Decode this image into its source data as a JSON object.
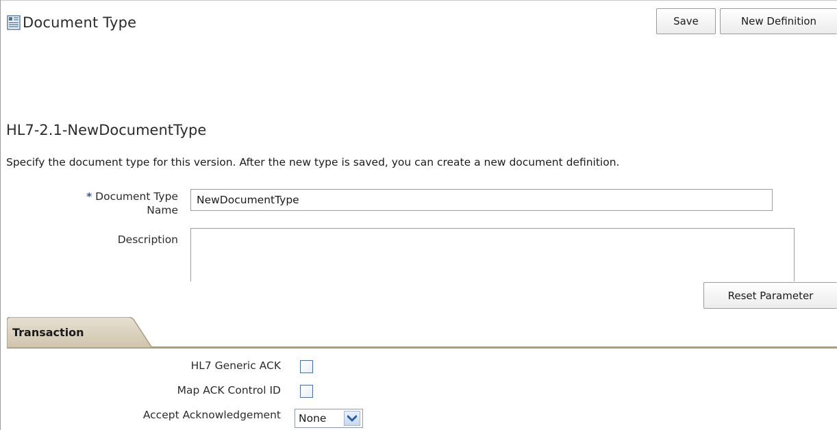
{
  "header": {
    "title": "Document Type",
    "icon": "document-type-icon"
  },
  "toolbar": {
    "save_label": "Save",
    "new_definition_label": "New Definition"
  },
  "form": {
    "subtitle": "HL7-2.1-NewDocumentType",
    "instructions": "Specify the document type for this version. After the new type is saved, you can create a new document definition.",
    "name_label_line1": "Document Type",
    "name_label_line2": "Name",
    "required_marker": "*",
    "name_value": "NewDocumentType",
    "description_label": "Description",
    "description_value": "",
    "reset_label": "Reset Parameter"
  },
  "tabs": [
    {
      "label": "Transaction",
      "active": true
    }
  ],
  "transaction": {
    "generic_ack_label": "HL7 Generic ACK",
    "generic_ack_checked": false,
    "map_ack_label": "Map ACK Control ID",
    "map_ack_checked": false,
    "accept_ack_label": "Accept Acknowledgement",
    "accept_ack_value": "None"
  },
  "colors": {
    "tab_fill": "#d8cfbd",
    "tab_border": "#a79b84",
    "required_star": "#2e5cb8",
    "checkbox_border": "#4a6fa0"
  }
}
